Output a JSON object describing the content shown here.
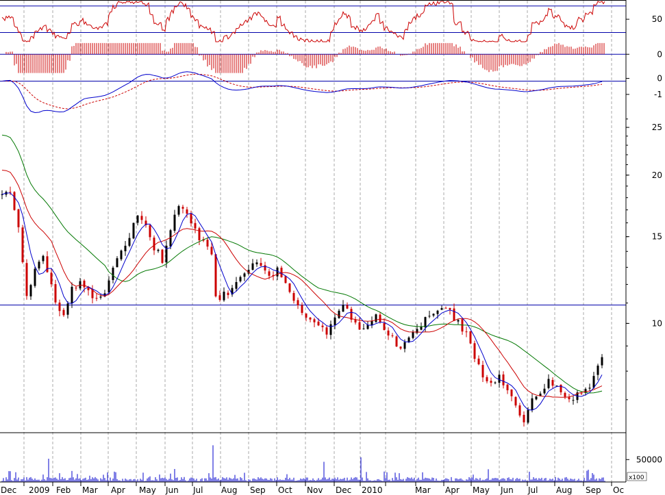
{
  "chart_data": {
    "type": "line",
    "title": "",
    "colors": {
      "price_up": "#000000",
      "price_down": "#cc0000",
      "ma_short": "#0000cc",
      "ma_mid": "#cc0000",
      "ma_long": "#007700",
      "volume": "#0000cc",
      "guide_line": "#0000aa",
      "oscillator": "#cc0000",
      "grid": "#aaaaaa"
    },
    "x_labels": [
      "Dec",
      "2009",
      "Feb",
      "Mar",
      "Apr",
      "May",
      "Jun",
      "Jul",
      "Aug",
      "Sep",
      "Oct",
      "Nov",
      "Dec",
      "2010",
      "Mar",
      "Apr",
      "May",
      "Jun",
      "Jul",
      "Aug",
      "Sep",
      "Oc"
    ],
    "price_panel": {
      "scale": "log",
      "ylim": [
        6,
        27
      ],
      "tick_labels": [
        "25",
        "20",
        "15",
        "10"
      ],
      "tick_values": [
        25,
        20,
        15,
        10
      ],
      "guide_level": 10.9,
      "close_anchors": [
        [
          0,
          18.5
        ],
        [
          2,
          18.2
        ],
        [
          4,
          15.5
        ],
        [
          6,
          11.5
        ],
        [
          8,
          12.8
        ],
        [
          10,
          13.5
        ],
        [
          13,
          11.0
        ],
        [
          15,
          10.5
        ],
        [
          17,
          11.8
        ],
        [
          19,
          12.0
        ],
        [
          21,
          11.5
        ],
        [
          23,
          11.3
        ],
        [
          25,
          11.5
        ],
        [
          27,
          12.8
        ],
        [
          29,
          14.0
        ],
        [
          31,
          15.0
        ],
        [
          33,
          16.5
        ],
        [
          35,
          15.8
        ],
        [
          37,
          14.3
        ],
        [
          39,
          13.5
        ],
        [
          41,
          15.5
        ],
        [
          43,
          17.2
        ],
        [
          45,
          16.8
        ],
        [
          47,
          15.5
        ],
        [
          49,
          14.5
        ],
        [
          51,
          14.0
        ],
        [
          52,
          11.5
        ],
        [
          53,
          11.3
        ],
        [
          55,
          11.5
        ],
        [
          57,
          12.0
        ],
        [
          59,
          12.5
        ],
        [
          61,
          13.3
        ],
        [
          63,
          13.0
        ],
        [
          65,
          12.5
        ],
        [
          67,
          12.8
        ],
        [
          69,
          12.0
        ],
        [
          71,
          11.0
        ],
        [
          73,
          10.5
        ],
        [
          75,
          10.3
        ],
        [
          77,
          10.0
        ],
        [
          79,
          9.6
        ],
        [
          81,
          10.2
        ],
        [
          83,
          10.8
        ],
        [
          85,
          10.3
        ],
        [
          87,
          9.8
        ],
        [
          89,
          10.0
        ],
        [
          91,
          10.5
        ],
        [
          93,
          9.8
        ],
        [
          95,
          9.4
        ],
        [
          97,
          8.8
        ],
        [
          99,
          9.3
        ],
        [
          101,
          9.6
        ],
        [
          103,
          10.2
        ],
        [
          105,
          10.6
        ],
        [
          107,
          10.9
        ],
        [
          109,
          10.5
        ],
        [
          111,
          10.0
        ],
        [
          113,
          9.5
        ],
        [
          115,
          8.5
        ],
        [
          117,
          7.8
        ],
        [
          119,
          7.6
        ],
        [
          121,
          7.8
        ],
        [
          123,
          7.3
        ],
        [
          125,
          6.7
        ],
        [
          127,
          6.4
        ],
        [
          129,
          7.0
        ],
        [
          131,
          7.2
        ],
        [
          133,
          7.6
        ],
        [
          135,
          7.4
        ],
        [
          137,
          7.2
        ],
        [
          139,
          7.0
        ],
        [
          141,
          7.3
        ],
        [
          143,
          7.4
        ],
        [
          145,
          8.2
        ],
        [
          146,
          8.6
        ]
      ]
    },
    "volume_panel": {
      "tick_labels": [
        "50000"
      ],
      "tick_values": [
        50000
      ],
      "unit_label": "x100",
      "ylim": [
        0,
        110000
      ],
      "spikes": [
        [
          11,
          52000
        ],
        [
          51,
          82000
        ],
        [
          78,
          45000
        ],
        [
          87,
          55000
        ],
        [
          142,
          25000
        ]
      ]
    },
    "oscillator_panel": {
      "tick_labels": [
        "50"
      ],
      "tick_values": [
        50
      ],
      "upper_band": 70,
      "lower_band": 30,
      "ylim": [
        15,
        78
      ]
    },
    "histogram_panel": {
      "tick_labels": [
        "0"
      ],
      "tick_values": [
        0
      ],
      "ylim": [
        -0.5,
        0.3
      ]
    },
    "macd_panel": {
      "tick_labels": [
        "0",
        "-1"
      ],
      "tick_values": [
        0,
        -1
      ],
      "ylim": [
        -2.5,
        0.6
      ]
    }
  }
}
